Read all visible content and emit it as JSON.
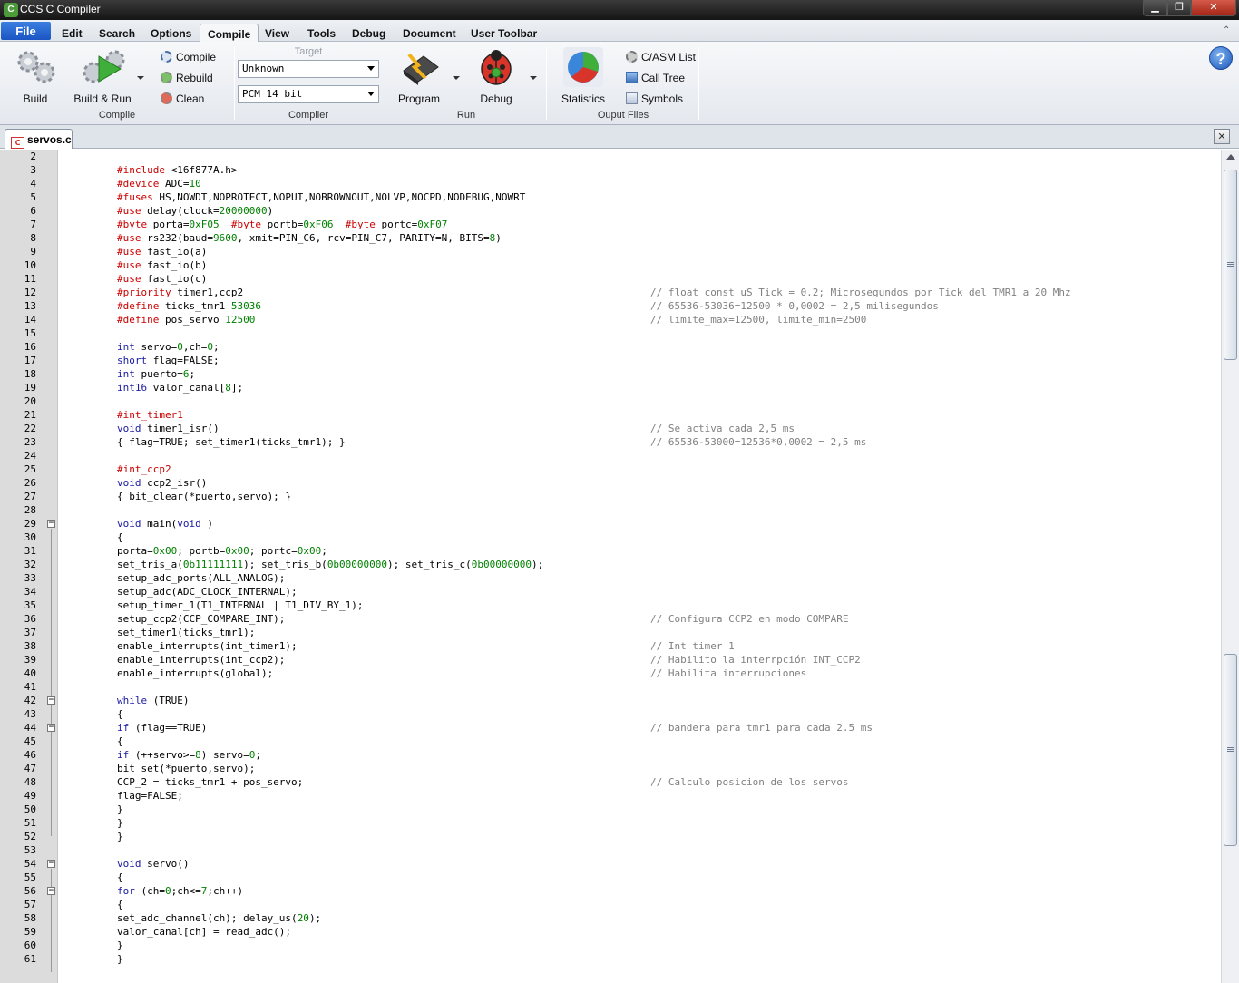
{
  "window": {
    "title": "CCS C Compiler"
  },
  "menu": {
    "file": "File",
    "items": [
      "Edit",
      "Search",
      "Options",
      "Compile",
      "View",
      "Tools",
      "Debug",
      "Document",
      "User Toolbar"
    ]
  },
  "ribbon": {
    "build": "Build",
    "build_run": "Build & Run",
    "compile": "Compile",
    "rebuild": "Rebuild",
    "clean": "Clean",
    "group_compile": "Compile",
    "target_label": "Target",
    "target_value": "Unknown",
    "compiler_value": "PCM 14 bit",
    "group_compiler": "Compiler",
    "program": "Program",
    "debug": "Debug",
    "group_run": "Run",
    "statistics": "Statistics",
    "casm_list": "C/ASM List",
    "call_tree": "Call Tree",
    "symbols": "Symbols",
    "group_output": "Ouput Files",
    "help": "?"
  },
  "tab": {
    "filename": "servos.c",
    "close": "✕"
  },
  "editor": {
    "first_line": 2,
    "lines": [
      {
        "code": [],
        "comment": ""
      },
      {
        "code": [
          [
            "k",
            "#include"
          ],
          [
            "",
            "<16f877A.h>"
          ]
        ],
        "comment": ""
      },
      {
        "code": [
          [
            "k",
            "#device"
          ],
          [
            "",
            "ADC="
          ],
          [
            "n",
            "10"
          ]
        ],
        "comment": ""
      },
      {
        "code": [
          [
            "k",
            "#fuses"
          ],
          [
            "",
            "HS,NOWDT,NOPROTECT,NOPUT,NOBROWNOUT,NOLVP,NOCPD,NODEBUG,NOWRT"
          ]
        ],
        "comment": ""
      },
      {
        "code": [
          [
            "k",
            "#use"
          ],
          [
            "",
            "delay(clock="
          ],
          [
            "n",
            "20000000"
          ],
          [
            "",
            ")"
          ]
        ],
        "comment": ""
      },
      {
        "code": [
          [
            "k",
            "#byte"
          ],
          [
            "",
            "porta="
          ],
          [
            "n",
            "0xF05"
          ],
          [
            "",
            ""
          ],
          [
            "k",
            "#byte"
          ],
          [
            "",
            "portb="
          ],
          [
            "n",
            "0xF06"
          ],
          [
            "",
            ""
          ],
          [
            "k",
            "#byte"
          ],
          [
            "",
            "portc="
          ],
          [
            "n",
            "0xF07"
          ]
        ],
        "comment": ""
      },
      {
        "code": [
          [
            "k",
            "#use"
          ],
          [
            "",
            "rs232(baud="
          ],
          [
            "n",
            "9600"
          ],
          [
            "",
            ", xmit=PIN_C6, rcv=PIN_C7, PARITY=N, BITS="
          ],
          [
            "n",
            "8"
          ],
          [
            "",
            ")"
          ]
        ],
        "comment": ""
      },
      {
        "code": [
          [
            "k",
            "#use"
          ],
          [
            "",
            "fast_io(a)"
          ]
        ],
        "comment": ""
      },
      {
        "code": [
          [
            "k",
            "#use"
          ],
          [
            "",
            "fast_io(b)"
          ]
        ],
        "comment": ""
      },
      {
        "code": [
          [
            "k",
            "#use"
          ],
          [
            "",
            "fast_io(c)"
          ]
        ],
        "comment": ""
      },
      {
        "code": [
          [
            "k",
            "#priority"
          ],
          [
            "",
            "timer1,ccp2"
          ]
        ],
        "comment": "// float const uS Tick = 0.2; Microsegundos por Tick del TMR1 a 20 Mhz"
      },
      {
        "code": [
          [
            "k",
            "#define"
          ],
          [
            "",
            "ticks_tmr1"
          ],
          [
            "n",
            "53036"
          ]
        ],
        "comment": "// 65536-53036=12500 * 0,0002 = 2,5 milisegundos"
      },
      {
        "code": [
          [
            "k",
            "#define"
          ],
          [
            "",
            "pos_servo"
          ],
          [
            "n",
            "12500"
          ]
        ],
        "comment": "// limite_max=12500, limite_min=2500"
      },
      {
        "code": [],
        "comment": ""
      },
      {
        "code": [
          [
            "t",
            "int"
          ],
          [
            "",
            "servo="
          ],
          [
            "n",
            "0"
          ],
          [
            "",
            ",ch="
          ],
          [
            "n",
            "0"
          ],
          [
            "",
            ";"
          ]
        ],
        "comment": ""
      },
      {
        "code": [
          [
            "t",
            "short"
          ],
          [
            "",
            "flag=FALSE;"
          ]
        ],
        "comment": ""
      },
      {
        "code": [
          [
            "t",
            "int"
          ],
          [
            "",
            "puerto="
          ],
          [
            "n",
            "6"
          ],
          [
            "",
            ";"
          ]
        ],
        "comment": ""
      },
      {
        "code": [
          [
            "t",
            "int16"
          ],
          [
            "",
            "valor_canal["
          ],
          [
            "n",
            "8"
          ],
          [
            "",
            "];"
          ]
        ],
        "comment": ""
      },
      {
        "code": [],
        "comment": ""
      },
      {
        "code": [
          [
            "k",
            "#int_timer1"
          ]
        ],
        "comment": ""
      },
      {
        "code": [
          [
            "t",
            "void"
          ],
          [
            "",
            "timer1_isr()"
          ]
        ],
        "comment": "// Se activa cada 2,5 ms"
      },
      {
        "code": [
          [
            "",
            "{ flag=TRUE; set_timer1(ticks_tmr1); }"
          ]
        ],
        "comment": "// 65536-53000=12536*0,0002 = 2,5 ms"
      },
      {
        "code": [],
        "comment": ""
      },
      {
        "code": [
          [
            "k",
            "#int_ccp2"
          ]
        ],
        "comment": ""
      },
      {
        "code": [
          [
            "t",
            "void"
          ],
          [
            "",
            "ccp2_isr()"
          ]
        ],
        "comment": ""
      },
      {
        "code": [
          [
            "",
            "{ bit_clear(*puerto,servo); }"
          ]
        ],
        "comment": ""
      },
      {
        "code": [],
        "comment": ""
      },
      {
        "code": [
          [
            "t",
            "void"
          ],
          [
            "",
            "main("
          ],
          [
            "t",
            "void"
          ],
          [
            "",
            ")"
          ]
        ],
        "comment": ""
      },
      {
        "code": [
          [
            "",
            "{"
          ]
        ],
        "comment": ""
      },
      {
        "code": [
          [
            "",
            "porta="
          ],
          [
            "n",
            "0x00"
          ],
          [
            "",
            "; portb="
          ],
          [
            "n",
            "0x00"
          ],
          [
            "",
            "; portc="
          ],
          [
            "n",
            "0x00"
          ],
          [
            "",
            ";"
          ]
        ],
        "comment": ""
      },
      {
        "code": [
          [
            "",
            "set_tris_a("
          ],
          [
            "n",
            "0b11111111"
          ],
          [
            "",
            "); set_tris_b("
          ],
          [
            "n",
            "0b00000000"
          ],
          [
            "",
            "); set_tris_c("
          ],
          [
            "n",
            "0b00000000"
          ],
          [
            "",
            ");"
          ]
        ],
        "comment": ""
      },
      {
        "code": [
          [
            "",
            "setup_adc_ports(ALL_ANALOG);"
          ]
        ],
        "comment": ""
      },
      {
        "code": [
          [
            "",
            "setup_adc(ADC_CLOCK_INTERNAL);"
          ]
        ],
        "comment": ""
      },
      {
        "code": [
          [
            "",
            "setup_timer_1(T1_INTERNAL | T1_DIV_BY_1);"
          ]
        ],
        "comment": ""
      },
      {
        "code": [
          [
            "",
            "setup_ccp2(CCP_COMPARE_INT);"
          ]
        ],
        "comment": "// Configura CCP2 en modo COMPARE"
      },
      {
        "code": [
          [
            "",
            "set_timer1(ticks_tmr1);"
          ]
        ],
        "comment": ""
      },
      {
        "code": [
          [
            "",
            "enable_interrupts(int_timer1);"
          ]
        ],
        "comment": "// Int timer 1"
      },
      {
        "code": [
          [
            "",
            "enable_interrupts(int_ccp2);"
          ]
        ],
        "comment": "// Habilito la interrpción INT_CCP2"
      },
      {
        "code": [
          [
            "",
            "enable_interrupts(global);"
          ]
        ],
        "comment": "// Habilita interrupciones"
      },
      {
        "code": [],
        "comment": ""
      },
      {
        "code": [
          [
            "t",
            "while"
          ],
          [
            "",
            "(TRUE)"
          ]
        ],
        "comment": ""
      },
      {
        "code": [
          [
            "",
            "{"
          ]
        ],
        "comment": ""
      },
      {
        "code": [
          [
            "t",
            "if"
          ],
          [
            "",
            "(flag==TRUE)"
          ]
        ],
        "comment": "// bandera para tmr1 para cada 2.5 ms"
      },
      {
        "code": [
          [
            "",
            "{"
          ]
        ],
        "comment": ""
      },
      {
        "code": [
          [
            "t",
            "if"
          ],
          [
            "",
            "(++servo>="
          ],
          [
            "n",
            "8"
          ],
          [
            "",
            ") servo="
          ],
          [
            "n",
            "0"
          ],
          [
            "",
            ";"
          ]
        ],
        "comment": ""
      },
      {
        "code": [
          [
            "",
            "bit_set(*puerto,servo);"
          ]
        ],
        "comment": ""
      },
      {
        "code": [
          [
            "",
            "CCP_2 = ticks_tmr1 + pos_servo;"
          ]
        ],
        "comment": "// Calculo posicion de los servos"
      },
      {
        "code": [
          [
            "",
            "flag=FALSE;"
          ]
        ],
        "comment": ""
      },
      {
        "code": [
          [
            "",
            "}"
          ]
        ],
        "comment": ""
      },
      {
        "code": [
          [
            "",
            "}"
          ]
        ],
        "comment": ""
      },
      {
        "code": [
          [
            "",
            "}"
          ]
        ],
        "comment": ""
      },
      {
        "code": [],
        "comment": ""
      },
      {
        "code": [
          [
            "t",
            "void"
          ],
          [
            "",
            "servo()"
          ]
        ],
        "comment": ""
      },
      {
        "code": [
          [
            "",
            "{"
          ]
        ],
        "comment": ""
      },
      {
        "code": [
          [
            "t",
            "for"
          ],
          [
            "",
            "(ch="
          ],
          [
            "n",
            "0"
          ],
          [
            "",
            ";ch<="
          ],
          [
            "n",
            "7"
          ],
          [
            "",
            ";ch++)"
          ]
        ],
        "comment": ""
      },
      {
        "code": [
          [
            "",
            "{"
          ]
        ],
        "comment": ""
      },
      {
        "code": [
          [
            "",
            "set_adc_channel(ch); delay_us("
          ],
          [
            "n",
            "20"
          ],
          [
            "",
            ");"
          ]
        ],
        "comment": ""
      },
      {
        "code": [
          [
            "",
            "valor_canal[ch] = read_adc();"
          ]
        ],
        "comment": ""
      },
      {
        "code": [
          [
            "",
            "}"
          ]
        ],
        "comment": ""
      },
      {
        "code": [
          [
            "",
            "}"
          ]
        ],
        "comment": ""
      }
    ],
    "fold_markers": [
      29,
      42,
      44,
      54,
      56
    ]
  },
  "scrollbar": {
    "position_fraction": 0.0
  }
}
